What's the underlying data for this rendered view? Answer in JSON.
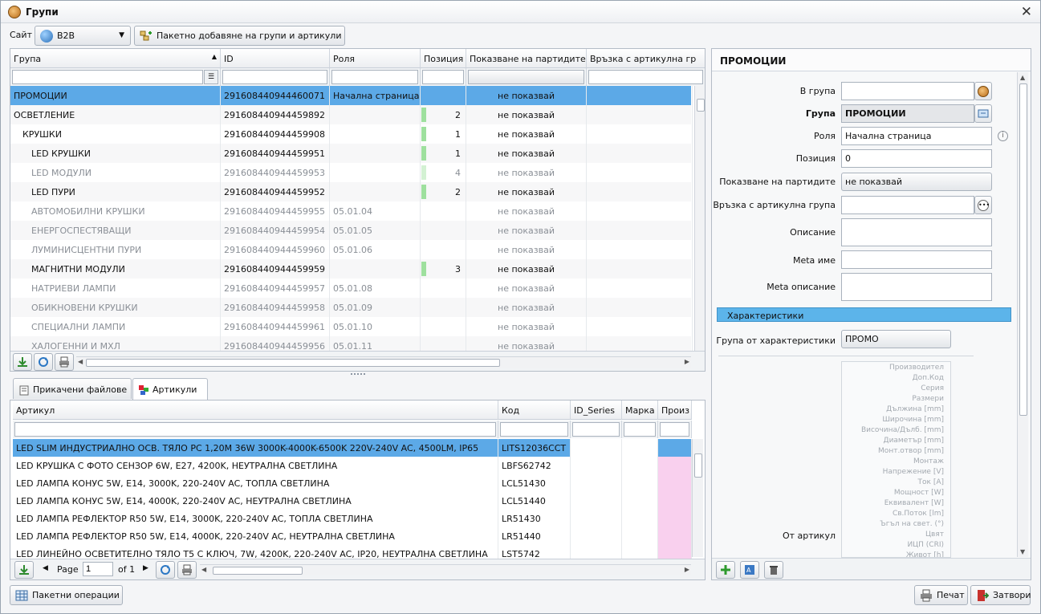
{
  "window": {
    "title": "Групи",
    "close": "✕"
  },
  "toolbar": {
    "site_label": "Сайт",
    "site_value": "B2B",
    "bulk_add": "Пакетно добавяне на групи и артикули"
  },
  "groups_table": {
    "columns": [
      "Група",
      "ID",
      "Роля",
      "Позиция",
      "Показване на партидите",
      "Връзка с артикулна гр"
    ],
    "rows": [
      {
        "name": "ПРОМОЦИИ",
        "id": "291608440944460071",
        "role": "Начална страница",
        "pos": "",
        "show": "не показвай",
        "level": 0,
        "active": true,
        "selected": true
      },
      {
        "name": "ОСВЕТЛЕНИЕ",
        "id": "291608440944459892",
        "role": "",
        "pos": "2",
        "show": "не показвай",
        "level": 0,
        "active": true
      },
      {
        "name": "КРУШКИ",
        "id": "291608440944459908",
        "role": "",
        "pos": "1",
        "show": "не показвай",
        "level": 1,
        "active": true
      },
      {
        "name": "LED КРУШКИ",
        "id": "291608440944459951",
        "role": "",
        "pos": "1",
        "show": "не показвай",
        "level": 2,
        "active": true
      },
      {
        "name": "LED МОДУЛИ",
        "id": "291608440944459953",
        "role": "",
        "pos": "4",
        "show": "не показвай",
        "level": 2,
        "active": false
      },
      {
        "name": "LED ПУРИ",
        "id": "291608440944459952",
        "role": "",
        "pos": "2",
        "show": "не показвай",
        "level": 2,
        "active": true
      },
      {
        "name": "АВТОМОБИЛНИ КРУШКИ",
        "id": "291608440944459955",
        "role": "05.01.04",
        "pos": "",
        "show": "не показвай",
        "level": 2,
        "active": false
      },
      {
        "name": "ЕНЕРГОСПЕСТЯВАЩИ",
        "id": "291608440944459954",
        "role": "05.01.05",
        "pos": "",
        "show": "не показвай",
        "level": 2,
        "active": false
      },
      {
        "name": "ЛУМИНИСЦЕНТНИ ПУРИ",
        "id": "291608440944459960",
        "role": "05.01.06",
        "pos": "",
        "show": "не показвай",
        "level": 2,
        "active": false
      },
      {
        "name": "МАГНИТНИ МОДУЛИ",
        "id": "291608440944459959",
        "role": "",
        "pos": "3",
        "show": "не показвай",
        "level": 2,
        "active": true
      },
      {
        "name": "НАТРИЕВИ ЛАМПИ",
        "id": "291608440944459957",
        "role": "05.01.08",
        "pos": "",
        "show": "не показвай",
        "level": 2,
        "active": false
      },
      {
        "name": "ОБИКНОВЕНИ КРУШКИ",
        "id": "291608440944459958",
        "role": "05.01.09",
        "pos": "",
        "show": "не показвай",
        "level": 2,
        "active": false
      },
      {
        "name": "СПЕЦИАЛНИ ЛАМПИ",
        "id": "291608440944459961",
        "role": "05.01.10",
        "pos": "",
        "show": "не показвай",
        "level": 2,
        "active": false
      },
      {
        "name": "ХАЛОГЕННИ И МХЛ",
        "id": "291608440944459956",
        "role": "05.01.11",
        "pos": "",
        "show": "не показвай",
        "level": 2,
        "active": false
      }
    ]
  },
  "tabs": [
    {
      "label": "Прикачени файлове"
    },
    {
      "label": "Артикули"
    }
  ],
  "articles_table": {
    "columns": [
      "Артикул",
      "Код",
      "ID_Series",
      "Марка",
      "Произ"
    ],
    "rows": [
      {
        "name": "LED SLIM ИНДУСТРИАЛНО ОСВ. ТЯЛО PC 1,20M 36W 3000K-4000K-6500K 220V-240V AC, 4500LM, IP65",
        "code": "LITS12036CCT",
        "selected": true
      },
      {
        "name": "LED КРУШКА С ФОТО СЕНЗОР 6W, E27, 4200K, НЕУТРАЛНА СВЕТЛИНА",
        "code": "LBFS62742"
      },
      {
        "name": "LED ЛАМПА КОНУС 5W, E14, 3000K, 220-240V AC, ТОПЛА СВЕТЛИНА",
        "code": "LCL51430"
      },
      {
        "name": "LED ЛАМПА КОНУС 5W, E14, 4000K, 220-240V AC, НЕУТРАЛНА СВЕТЛИНА",
        "code": "LCL51440"
      },
      {
        "name": "LED ЛАМПА РЕФЛЕКТОР R50 5W, E14, 3000K, 220-240V AC, ТОПЛА СВЕТЛИНА",
        "code": "LR51430"
      },
      {
        "name": "LED ЛАМПА РЕФЛЕКТОР R50 5W, E14, 4000K, 220-240V AC, НЕУТРАЛНА СВЕТЛИНА",
        "code": "LR51440"
      },
      {
        "name": "LED ЛИНЕЙНО ОСВЕТИТЕЛНО ТЯЛО T5 С КЛЮЧ, 7W, 4200K, 220-240V AC, IP20, НЕУТРАЛНА СВЕТЛИНА",
        "code": "LST5742"
      }
    ],
    "pager": {
      "page_label": "Page",
      "page_value": "1",
      "of_label": "of 1"
    }
  },
  "form": {
    "title": "ПРОМОЦИИ",
    "in_group_label": "В група",
    "in_group_value": "",
    "group_label": "Група",
    "group_value": "ПРОМОЦИИ",
    "role_label": "Роля",
    "role_value": "Начална страница",
    "position_label": "Позиция",
    "position_value": "0",
    "show_label": "Показване на партидите",
    "show_value": "не показвай",
    "link_label": "Връзка с артикулна група",
    "link_value": "",
    "desc_label": "Описание",
    "meta_name_label": "Meta име",
    "meta_desc_label": "Meta описание",
    "section": "Характеристики",
    "char_group_label": "Група от характеристики",
    "char_group_value": "ПРОМО",
    "from_article_label": "От артикул",
    "characteristics": [
      "Производител",
      "Доп.Код",
      "Серия",
      "Размери",
      "Дължина [mm]",
      "Широчина [mm]",
      "Височина/Дълб. [mm]",
      "Диаметър [mm]",
      "Монт.отвор [mm]",
      "Монтаж",
      "Напрежение [V]",
      "Ток [A]",
      "Мощност [W]",
      "Еквивалент [W]",
      "Св.Поток [lm]",
      "Ъгъл на свет. (°)",
      "Цвят",
      "ИЦП (CRI)",
      "Живот [h]"
    ]
  },
  "footer": {
    "bulk_ops": "Пакетни операции",
    "print": "Печат",
    "close": "Затвори"
  },
  "colors": {
    "selected_row": "#5ca9e7",
    "section_bar": "#5cb4ea",
    "position_bar": "#9ee09e",
    "pink_cell": "#f9d0ee"
  }
}
